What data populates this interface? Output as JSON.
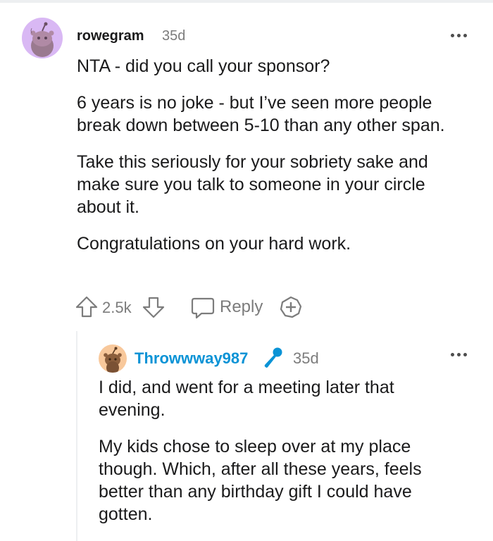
{
  "comment": {
    "username": "rowegram",
    "time": "35d",
    "paragraphs": [
      "NTA - did you call your sponsor?",
      "6 years is no joke - but I’ve seen more people break down between 5-10 than any other span.",
      "Take this seriously for your sobriety sake and make sure you talk to someone in your circle about it.",
      "Congratulations on your hard work."
    ],
    "votes": "2.5k",
    "reply_label": "Reply"
  },
  "reply": {
    "username": "Throwwway987",
    "time": "35d",
    "paragraphs": [
      "I did, and went for a meeting later that evening.",
      "My kids chose to sleep over at my place though. Which, after all these years, feels better than any birthday gift I could have gotten."
    ]
  },
  "colors": {
    "username_op": "#0a93d6",
    "avatar_1": "#d9b8f4",
    "avatar_2": "#f8c89b",
    "meta_gray": "#7c7c7c"
  },
  "icons": [
    "snoo-avatar-icon",
    "more-options-icon",
    "upvote-icon",
    "downvote-icon",
    "reply-icon",
    "award-icon",
    "microphone-icon"
  ]
}
